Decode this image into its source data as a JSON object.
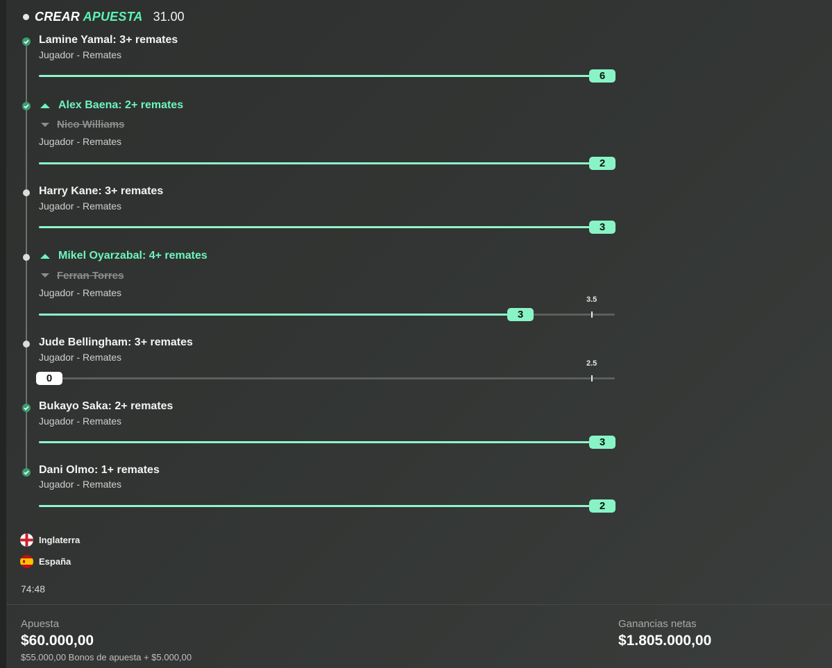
{
  "header": {
    "title_part1": "CREAR",
    "title_part2": "APUESTA",
    "odds": "31.00"
  },
  "legs": [
    {
      "title": "Lamine Yamal: 3+ remates",
      "subtitle": "Jugador - Remates",
      "value": "6",
      "status": "won",
      "progress": 1.0
    },
    {
      "title": "Alex Baena: 2+ remates",
      "replaced": "Nico Williams",
      "subtitle": "Jugador - Remates",
      "value": "2",
      "status": "won",
      "progress": 1.0
    },
    {
      "title": "Harry Kane: 3+ remates",
      "subtitle": "Jugador - Remates",
      "value": "3",
      "status": "pending",
      "progress": 1.0
    },
    {
      "title": "Mikel Oyarzabal: 4+ remates",
      "replaced": "Ferran Torres",
      "subtitle": "Jugador - Remates",
      "value": "3",
      "threshold": "3.5",
      "status": "pending",
      "progress": 0.857
    },
    {
      "title": "Jude Bellingham: 3+ remates",
      "subtitle": "Jugador - Remates",
      "value": "0",
      "threshold": "2.5",
      "status": "pending",
      "progress": 0.0
    },
    {
      "title": "Bukayo Saka: 2+ remates",
      "subtitle": "Jugador - Remates",
      "value": "3",
      "status": "won",
      "progress": 1.0
    },
    {
      "title": "Dani Olmo: 1+ remates",
      "subtitle": "Jugador - Remates",
      "value": "2",
      "status": "won",
      "progress": 1.0
    }
  ],
  "teams": [
    {
      "name": "Inglaterra",
      "flag": "england-flag-icon"
    },
    {
      "name": "España",
      "flag": "spain-flag-icon"
    }
  ],
  "clock": "74:48",
  "footer": {
    "stake_label": "Apuesta",
    "stake_amount": "$60.000,00",
    "stake_breakdown": "$55.000,00 Bonos de apuesta + $5.000,00",
    "winnings_label": "Ganancias netas",
    "winnings_amount": "$1.805.000,00"
  },
  "colors": {
    "accent_green": "#6ef5bd",
    "fill_green": "#8ff5cb",
    "check_green": "#3a9e73",
    "background": "#323533"
  }
}
